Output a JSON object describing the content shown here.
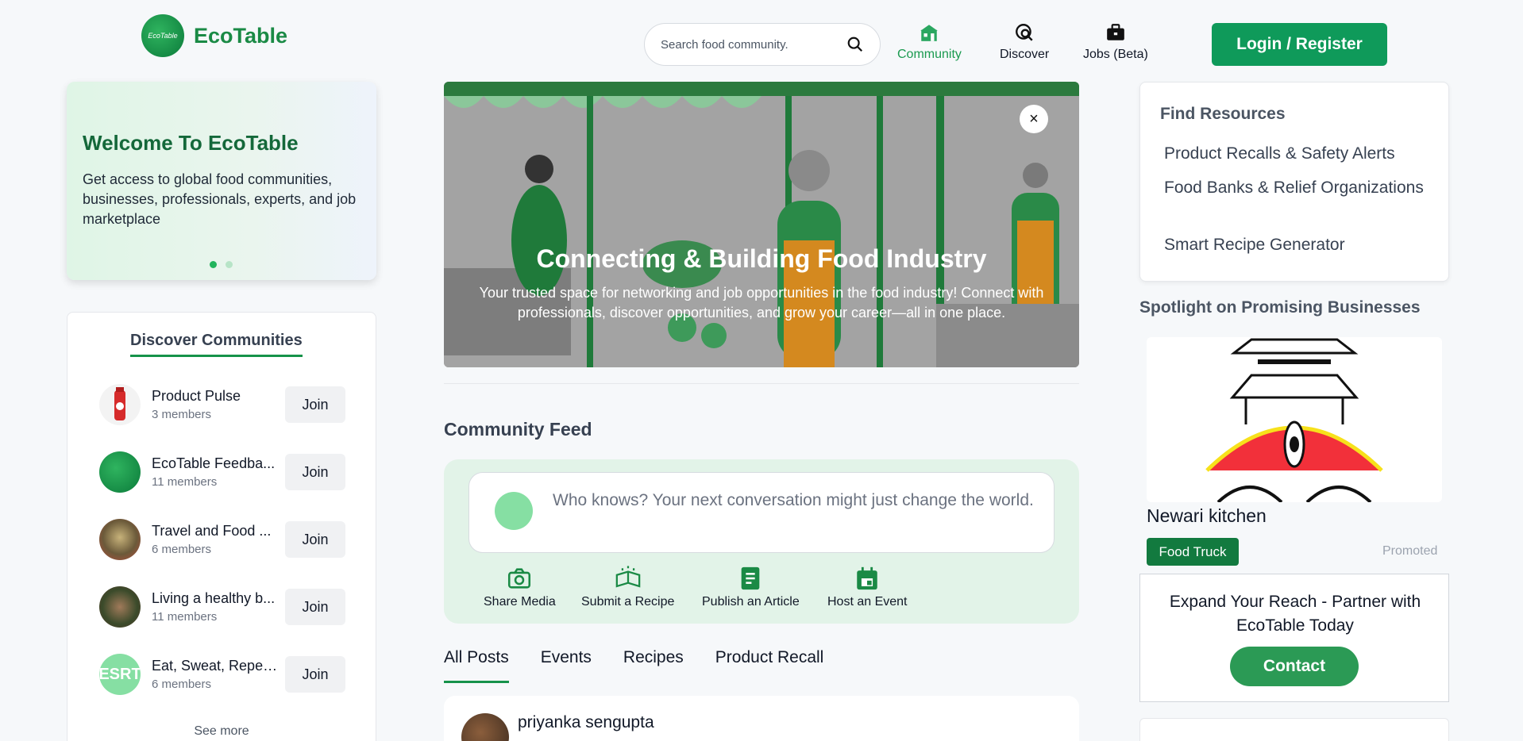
{
  "header": {
    "logo_text": "EcoTable",
    "logo_mark_text": "EcoTable",
    "search_placeholder": "Search food community.",
    "nav": [
      {
        "label": "Community",
        "icon": "community-icon",
        "active": true
      },
      {
        "label": "Discover",
        "icon": "discover-icon",
        "active": false
      },
      {
        "label": "Jobs (Beta)",
        "icon": "briefcase-icon",
        "active": false
      }
    ],
    "login_label": "Login / Register"
  },
  "welcome": {
    "title": "Welcome To EcoTable",
    "text": "Get access to global food communities, businesses, professionals, experts, and job marketplace",
    "slides": 2,
    "active_slide": 1
  },
  "communities": {
    "title": "Discover Communities",
    "items": [
      {
        "name": "Product Pulse",
        "members": "3 members",
        "join": "Join"
      },
      {
        "name": "EcoTable Feedba...",
        "members": "11 members",
        "join": "Join"
      },
      {
        "name": "Travel and Food ...",
        "members": "6 members",
        "join": "Join"
      },
      {
        "name": "Living a healthy b...",
        "members": "11 members",
        "join": "Join"
      },
      {
        "name": "Eat, Sweat, Repea...",
        "members": "6 members",
        "join": "Join",
        "avatar_text": "ESRT"
      }
    ],
    "see_more": "See more"
  },
  "hero": {
    "title": "Connecting & Building Food Industry",
    "subtitle": "Your trusted space for networking and job opportunities in the food industry! Connect with professionals, discover opportunities, and grow your career—all in one place.",
    "close": "×"
  },
  "feed": {
    "title": "Community Feed",
    "composer_placeholder": "Who knows? Your next conversation might just change the world.",
    "actions": [
      {
        "label": "Share Media",
        "icon": "camera-icon"
      },
      {
        "label": "Submit a Recipe",
        "icon": "recipe-book-icon"
      },
      {
        "label": "Publish an Article",
        "icon": "article-icon"
      },
      {
        "label": "Host an Event",
        "icon": "calendar-icon"
      }
    ],
    "tabs": [
      "All Posts",
      "Events",
      "Recipes",
      "Product Recall"
    ],
    "active_tab": 0,
    "post": {
      "author": "priyanka sengupta"
    }
  },
  "resources": {
    "title": "Find Resources",
    "links": [
      "Product Recalls & Safety Alerts",
      "Food Banks & Relief Organizations",
      "Smart Recipe Generator"
    ]
  },
  "spotlight": {
    "title": "Spotlight on Promising Businesses",
    "business_name": "Newari kitchen",
    "category": "Food Truck",
    "promoted": "Promoted"
  },
  "partner": {
    "text": "Expand Your Reach - Partner with EcoTable Today",
    "button": "Contact"
  },
  "colors": {
    "brand_green": "#0f9a5a",
    "accent_green": "#16924a",
    "composer_bg": "#e2f3e8"
  }
}
